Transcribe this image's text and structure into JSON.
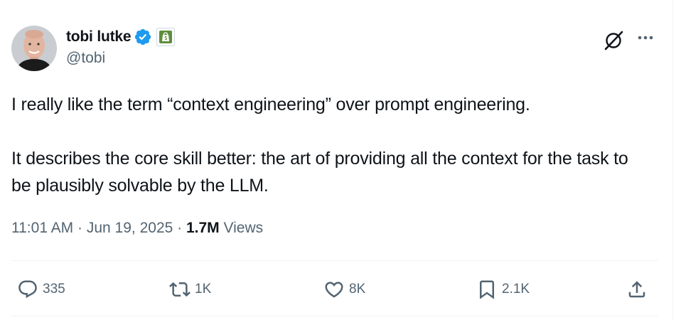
{
  "author": {
    "display_name": "tobi lutke",
    "handle": "@tobi",
    "avatar_icon": "avatar-photo",
    "verified_icon": "verified-badge-icon",
    "affiliation_icon": "shopify-bag-icon"
  },
  "tweet": {
    "text": "I really like the term “context engineering” over prompt engineering.\n\nIt describes the core skill better: the art of providing all the context for the task to be plausibly solvable by the LLM.",
    "time": "11:01 AM",
    "date": "Jun 19, 2025",
    "separator": "·",
    "views_count": "1.7M",
    "views_label": "Views"
  },
  "actions": {
    "replies": "335",
    "reposts": "1K",
    "likes": "8K",
    "bookmarks": "2.1K"
  },
  "colors": {
    "text": "#0f1419",
    "secondary": "#536471",
    "verified": "#1d9bf0",
    "affiliation": "#5e8e3e",
    "divider": "#eff3f4"
  }
}
